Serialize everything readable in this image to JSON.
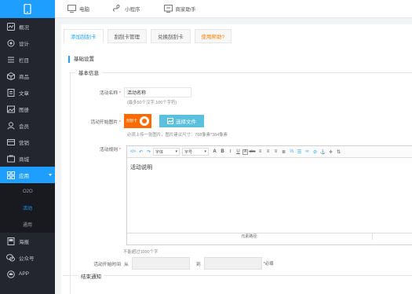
{
  "sidebar": {
    "logo_icon": "mobile-phone-icon",
    "items": [
      {
        "label": "概况",
        "icon": "dashboard-icon"
      },
      {
        "label": "设计",
        "icon": "design-icon"
      },
      {
        "label": "栏目",
        "icon": "list-icon"
      },
      {
        "label": "商品",
        "icon": "cube-icon"
      },
      {
        "label": "文章",
        "icon": "article-icon"
      },
      {
        "label": "图册",
        "icon": "image-icon"
      },
      {
        "label": "会员",
        "icon": "user-icon"
      },
      {
        "label": "营销",
        "icon": "marketing-icon"
      },
      {
        "label": "商城",
        "icon": "shop-icon"
      },
      {
        "label": "应用",
        "icon": "apps-icon"
      }
    ],
    "subitems": [
      "O2O",
      "活动",
      "通用"
    ],
    "items_bottom": [
      {
        "label": "海报",
        "icon": "poster-icon"
      },
      {
        "label": "公众号",
        "icon": "wechat-icon"
      },
      {
        "label": "APP",
        "icon": "android-icon"
      }
    ]
  },
  "topbar": {
    "items": [
      {
        "label": "电脑",
        "icon": "monitor-icon"
      },
      {
        "label": "小程序",
        "icon": "mini-program-icon"
      },
      {
        "label": "商家助手",
        "icon": "merchant-icon"
      }
    ]
  },
  "tabs": [
    "添加刮刮卡",
    "刮刮卡管理",
    "兑换刮刮卡",
    "使用帮助?"
  ],
  "section_title": "基础设置",
  "basic_legend": "基本信息",
  "form": {
    "name_label": "活动名称",
    "required_mark": "*",
    "name_value": "活动名称",
    "name_hint": "(最多50个汉字,100个字符)",
    "image_label": "活动开始图片",
    "thumb_text": "刮刮卡",
    "upload_button": "选择文件",
    "image_hint": "必须上传一张图片，图片建议尺寸：768像素*384像素",
    "desc_label": "活动规则",
    "font_select": "字体",
    "size_select": "字号",
    "editor_body": "活动说明",
    "editor_footer": "元素路径:",
    "limit_hint": "不能超过1000个字",
    "time_label": "活动开始时间",
    "time_from": "从",
    "time_to": "到",
    "time_required": "*必填"
  },
  "end_legend": "结束通知",
  "colors": {
    "accent": "#1e9fff",
    "sidebar": "#23262e",
    "help": "#ff7f00",
    "required": "#ff5722"
  }
}
